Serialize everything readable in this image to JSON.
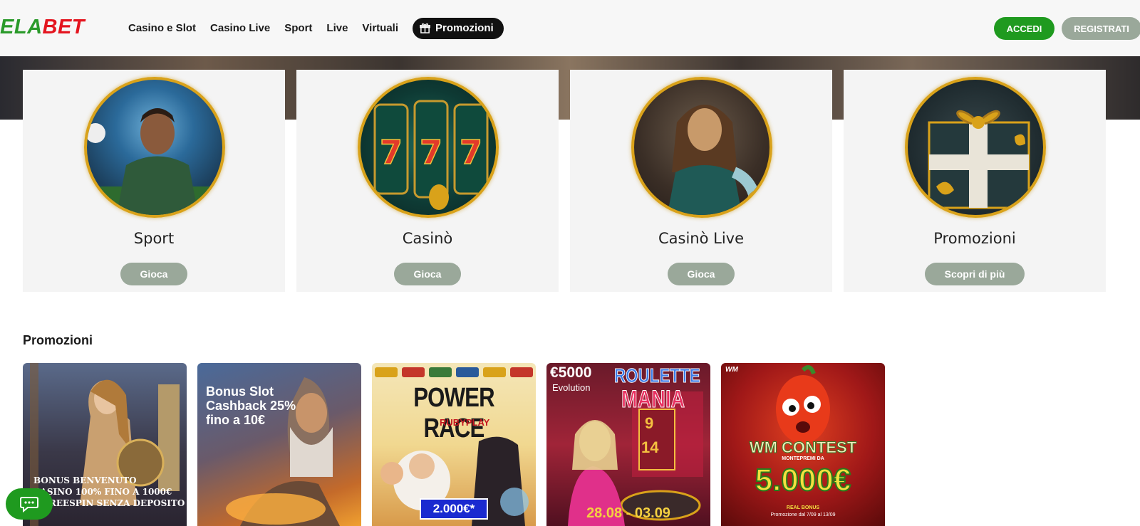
{
  "header": {
    "logo_part1": "EL",
    "logo_part2": "A",
    "logo_part3": "BET",
    "nav": [
      "Casino e Slot",
      "Casino Live",
      "Sport",
      "Live",
      "Virtuali"
    ],
    "promo_label": "Promozioni",
    "login_label": "ACCEDI",
    "register_label": "REGISTRATI"
  },
  "categories": [
    {
      "title": "Sport",
      "button": "Gioca"
    },
    {
      "title": "Casinò",
      "button": "Gioca"
    },
    {
      "title": "Casinò Live",
      "button": "Gioca"
    },
    {
      "title": "Promozioni",
      "button": "Scopri di più"
    }
  ],
  "promotions": {
    "title": "Promozioni",
    "cards": [
      {
        "line1": "BONUS BENVENUTO",
        "line2": "CASINO 100% FINO A 1000€",
        "line3": "E FREESPIN SENZA DEPOSITO"
      },
      {
        "line1": "Bonus Slot",
        "line2": "Cashback 25%",
        "line3": "fino a 10€"
      },
      {
        "title": "POWER RACE",
        "provider": "RUBYPLAY",
        "prize": "2.000€*"
      },
      {
        "amount": "€5000",
        "provider": "Evolution",
        "title1": "ROULETTE",
        "title2": "MANIA",
        "dates": "28.08 - 03.09",
        "num1": "9",
        "num2": "14"
      },
      {
        "brand": "WM",
        "title": "WM CONTEST",
        "sub": "MONTEPREMI DA",
        "prize": "5.000€",
        "note": "REAL BONUS",
        "period": "Promozione dal 7/09 al 13/09"
      }
    ]
  },
  "colors": {
    "brand_green": "#1f9a1f",
    "brand_red": "#e4151f",
    "muted_button": "#9aa89a",
    "gold_ring": "#d9a21a"
  }
}
